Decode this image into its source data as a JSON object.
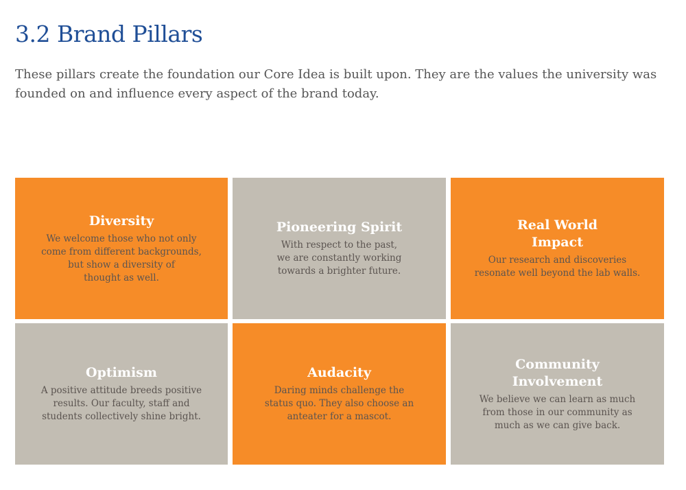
{
  "header": {
    "title": "3.2 Brand Pillars",
    "intro": "These pillars create the foundation our Core Idea is built upon. They are the values the university was founded on and influence every aspect of the brand today."
  },
  "colors": {
    "title": "#1f4e96",
    "orange": "#f68c28",
    "gray": "#c2bdb3",
    "tile_title": "#ffffff",
    "tile_text": "#5b5450"
  },
  "pillars": [
    {
      "title": "Diversity",
      "description": "We welcome those who not only\ncome from different backgrounds,\nbut show a diversity of\nthought as well.",
      "color": "orange"
    },
    {
      "title": "Pioneering Spirit",
      "description": "With respect to the past,\nwe are constantly working\ntowards a brighter future.",
      "color": "gray"
    },
    {
      "title": "Real World\nImpact",
      "description": "Our research and discoveries\nresonate well beyond the lab walls.",
      "color": "orange"
    },
    {
      "title": "Optimism",
      "description": "A positive attitude breeds positive\nresults. Our faculty, staff and\nstudents collectively shine bright.",
      "color": "gray"
    },
    {
      "title": "Audacity",
      "description": "Daring minds challenge the\nstatus quo. They also choose an\nanteater for a mascot.",
      "color": "orange"
    },
    {
      "title": "Community\nInvolvement",
      "description": "We believe we can learn as much\nfrom those in our community as\nmuch as we can give back.",
      "color": "gray"
    }
  ]
}
